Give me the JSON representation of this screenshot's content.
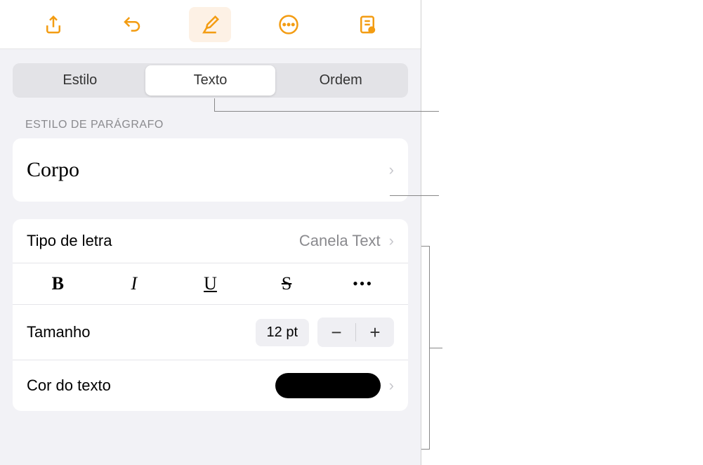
{
  "toolbar": {
    "share": "share-icon",
    "undo": "undo-icon",
    "format": "format-brush-icon",
    "more": "more-icon",
    "readmode": "reader-icon"
  },
  "tabs": {
    "style": "Estilo",
    "text": "Texto",
    "order": "Ordem"
  },
  "paragraph": {
    "header": "ESTILO DE PARÁGRAFO",
    "name": "Corpo"
  },
  "font": {
    "label": "Tipo de letra",
    "value": "Canela Text"
  },
  "format": {
    "bold": "B",
    "italic": "I",
    "underline": "U",
    "strike": "S",
    "more": "•••"
  },
  "size": {
    "label": "Tamanho",
    "value": "12 pt",
    "minus": "−",
    "plus": "+"
  },
  "color": {
    "label": "Cor do texto",
    "value": "#000000"
  }
}
